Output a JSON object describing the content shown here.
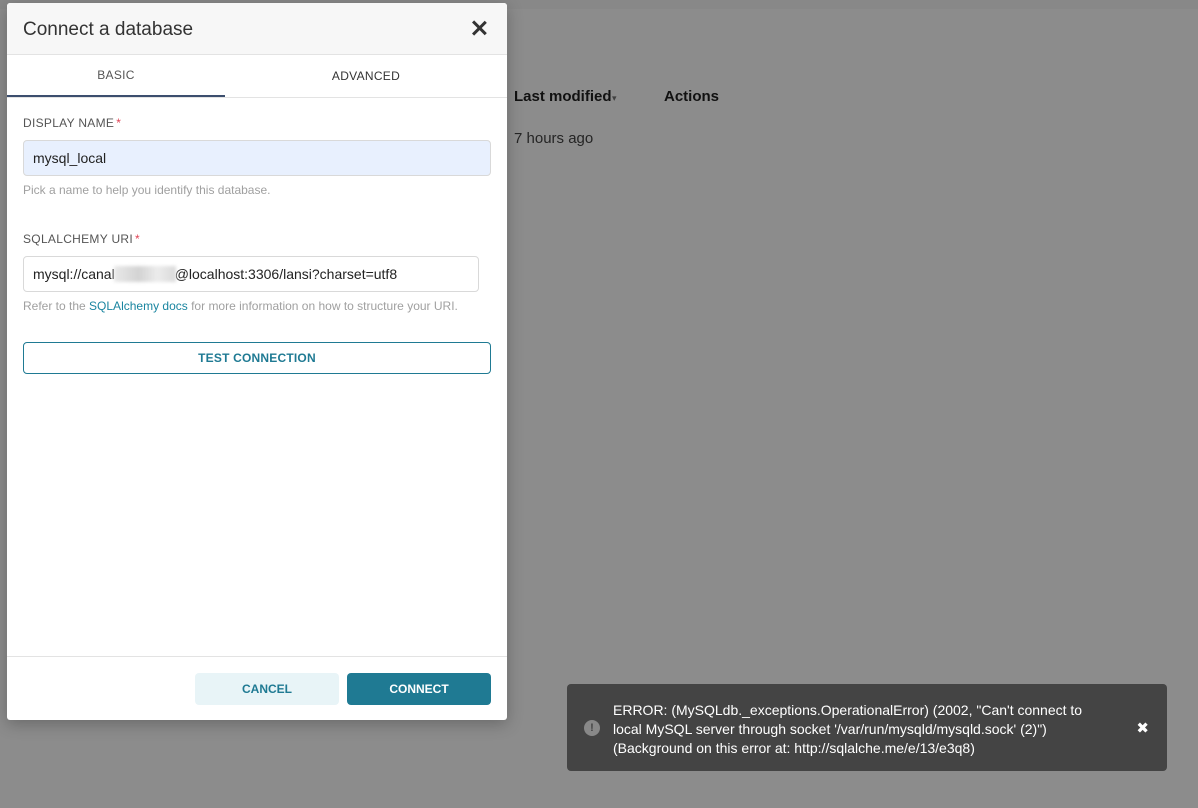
{
  "background": {
    "columns": {
      "last_modified": "Last modified",
      "actions": "Actions"
    },
    "row": {
      "last_modified": "7 hours ago"
    }
  },
  "modal": {
    "title": "Connect a database",
    "tabs": [
      {
        "label": "BASIC",
        "active": true
      },
      {
        "label": "ADVANCED",
        "active": false
      }
    ],
    "display_name": {
      "label": "DISPLAY NAME",
      "required_marker": "*",
      "value": "mysql_local",
      "helper": "Pick a name to help you identify this database."
    },
    "sqlalchemy_uri": {
      "label": "SQLALCHEMY URI",
      "required_marker": "*",
      "value_prefix": "mysql://canal",
      "value_suffix": "@localhost:3306/lansi?charset=utf8",
      "helper_prefix": "Refer to the ",
      "helper_link": "SQLAlchemy docs",
      "helper_suffix": " for more information on how to structure your URI."
    },
    "test_button": "TEST CONNECTION",
    "cancel_button": "CANCEL",
    "connect_button": "CONNECT"
  },
  "toast": {
    "icon": "!",
    "message": "ERROR: (MySQLdb._exceptions.OperationalError) (2002, \"Can't connect to local MySQL server through socket '/var/run/mysqld/mysqld.sock' (2)\") (Background on this error at: http://sqlalche.me/e/13/e3q8)",
    "close_glyph": "✖"
  },
  "colors": {
    "accent": "#1f7a93",
    "toast_bg": "#444444",
    "required": "#e04355",
    "autofill_bg": "#e8f0fe"
  }
}
